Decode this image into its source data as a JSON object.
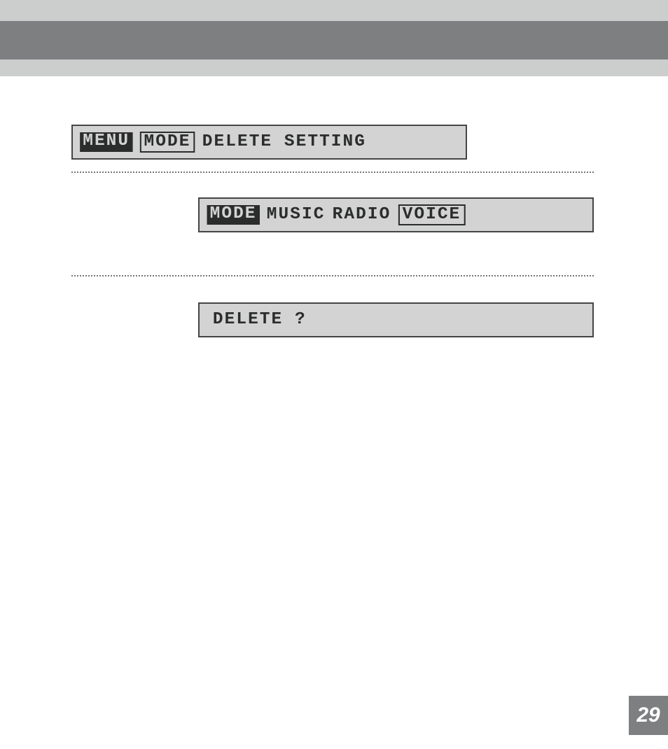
{
  "lcd1": {
    "chip_menu": "MENU",
    "chip_mode": "MODE",
    "text": "DELETE SETTING"
  },
  "lcd2": {
    "chip_mode": "MODE",
    "text_music": "MUSIC",
    "text_radio": "RADIO",
    "chip_voice": "VOICE"
  },
  "lcd3": {
    "text": "DELETE ?"
  },
  "page_number": "29"
}
